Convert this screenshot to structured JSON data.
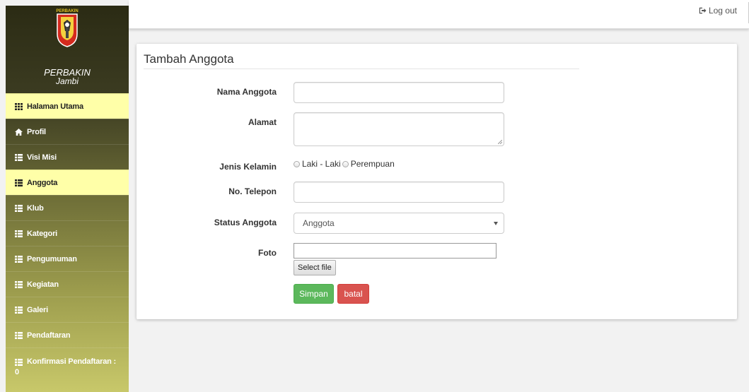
{
  "brand": {
    "logo_text": "PERBAKIN",
    "title": "PERBAKIN",
    "subtitle": "Jambi"
  },
  "menu": [
    {
      "label": "Halaman Utama",
      "icon": "grid-icon",
      "active": true
    },
    {
      "label": "Profil",
      "icon": "home-icon",
      "active": false
    },
    {
      "label": "Visi Misi",
      "icon": "list-icon",
      "active": false
    },
    {
      "label": "Anggota",
      "icon": "list-icon",
      "active": true
    },
    {
      "label": "Klub",
      "icon": "list-icon",
      "active": false
    },
    {
      "label": "Kategori",
      "icon": "list-icon",
      "active": false
    },
    {
      "label": "Pengumuman",
      "icon": "list-icon",
      "active": false
    },
    {
      "label": "Kegiatan",
      "icon": "list-icon",
      "active": false
    },
    {
      "label": "Galeri",
      "icon": "list-icon",
      "active": false
    },
    {
      "label": "Pendaftaran",
      "icon": "list-icon",
      "active": false
    },
    {
      "label": "Konfirmasi Pendaftaran :",
      "icon": "list-icon",
      "active": false,
      "count": "0"
    }
  ],
  "topbar": {
    "logout_label": "Log out",
    "logout_icon": "logout-icon"
  },
  "form": {
    "title": "Tambah Anggota",
    "fields": {
      "nama": {
        "label": "Nama Anggota",
        "value": "",
        "placeholder": ""
      },
      "alamat": {
        "label": "Alamat",
        "value": ""
      },
      "jenis_kelamin": {
        "label": "Jenis Kelamin",
        "options": [
          "Laki - Laki",
          "Perempuan"
        ],
        "selected": null
      },
      "telepon": {
        "label": "No. Telepon",
        "value": "",
        "placeholder": ""
      },
      "status": {
        "label": "Status Anggota",
        "selected": "Anggota"
      },
      "foto": {
        "label": "Foto",
        "button_label": "Select file"
      }
    },
    "save_label": "Simpan",
    "cancel_label": "batal"
  },
  "colors": {
    "active_menu_bg": "#ffffa8",
    "save_button": "#5cb85c",
    "cancel_button": "#d9534f"
  }
}
